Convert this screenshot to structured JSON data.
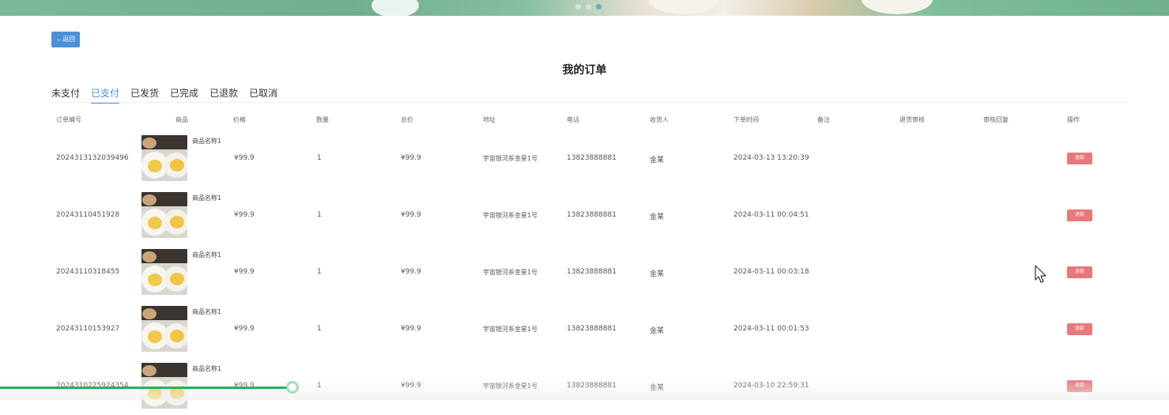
{
  "back_button": {
    "label": "←返回"
  },
  "title": "我的订单",
  "tabs": [
    {
      "label": "未支付",
      "active": false
    },
    {
      "label": "已支付",
      "active": true
    },
    {
      "label": "已发货",
      "active": false
    },
    {
      "label": "已完成",
      "active": false
    },
    {
      "label": "已退款",
      "active": false
    },
    {
      "label": "已取消",
      "active": false
    }
  ],
  "columns": [
    "订单编号",
    "商品",
    "价格",
    "数量",
    "总价",
    "地址",
    "电话",
    "收货人",
    "下单时间",
    "备注",
    "退货审核",
    "审核回复",
    "操作"
  ],
  "orders": [
    {
      "order_no": "20243131320394​96",
      "product": "商品名称1",
      "price": "¥99.9",
      "qty": "1",
      "total": "¥99.9",
      "address": "宇宙银河系金星1号",
      "phone": "13823888881",
      "receiver": "金某",
      "time": "2024-03-13 13:20:39",
      "action": "退款"
    },
    {
      "order_no": "20243110451928",
      "product": "商品名称1",
      "price": "¥99.9",
      "qty": "1",
      "total": "¥99.9",
      "address": "宇宙银河系金星1号",
      "phone": "13823888881",
      "receiver": "金某",
      "time": "2024-03-11 00:04:51",
      "action": "退款"
    },
    {
      "order_no": "20243110318455",
      "product": "商品名称1",
      "price": "¥99.9",
      "qty": "1",
      "total": "¥99.9",
      "address": "宇宙银河系金星1号",
      "phone": "13823888881",
      "receiver": "金某",
      "time": "2024-03-11 00:03:18",
      "action": "退款"
    },
    {
      "order_no": "20243110153927",
      "product": "商品名称1",
      "price": "¥99.9",
      "qty": "1",
      "total": "¥99.9",
      "address": "宇宙银河系金星1号",
      "phone": "13823888881",
      "receiver": "金某",
      "time": "2024-03-11 00:01:53",
      "action": "退款"
    },
    {
      "order_no": "20243102259​24354",
      "product": "商品名称1",
      "price": "¥99.9",
      "qty": "1",
      "total": "¥99.9",
      "address": "宇宙银河系金星1号",
      "phone": "13823888881",
      "receiver": "金某",
      "time": "2024-03-10 22:59:31",
      "action": "退款"
    }
  ],
  "video_progress": 0.25,
  "colors": {
    "primary": "#4a90d9",
    "refund": "#e8787a",
    "progress": "#1fb35a"
  }
}
